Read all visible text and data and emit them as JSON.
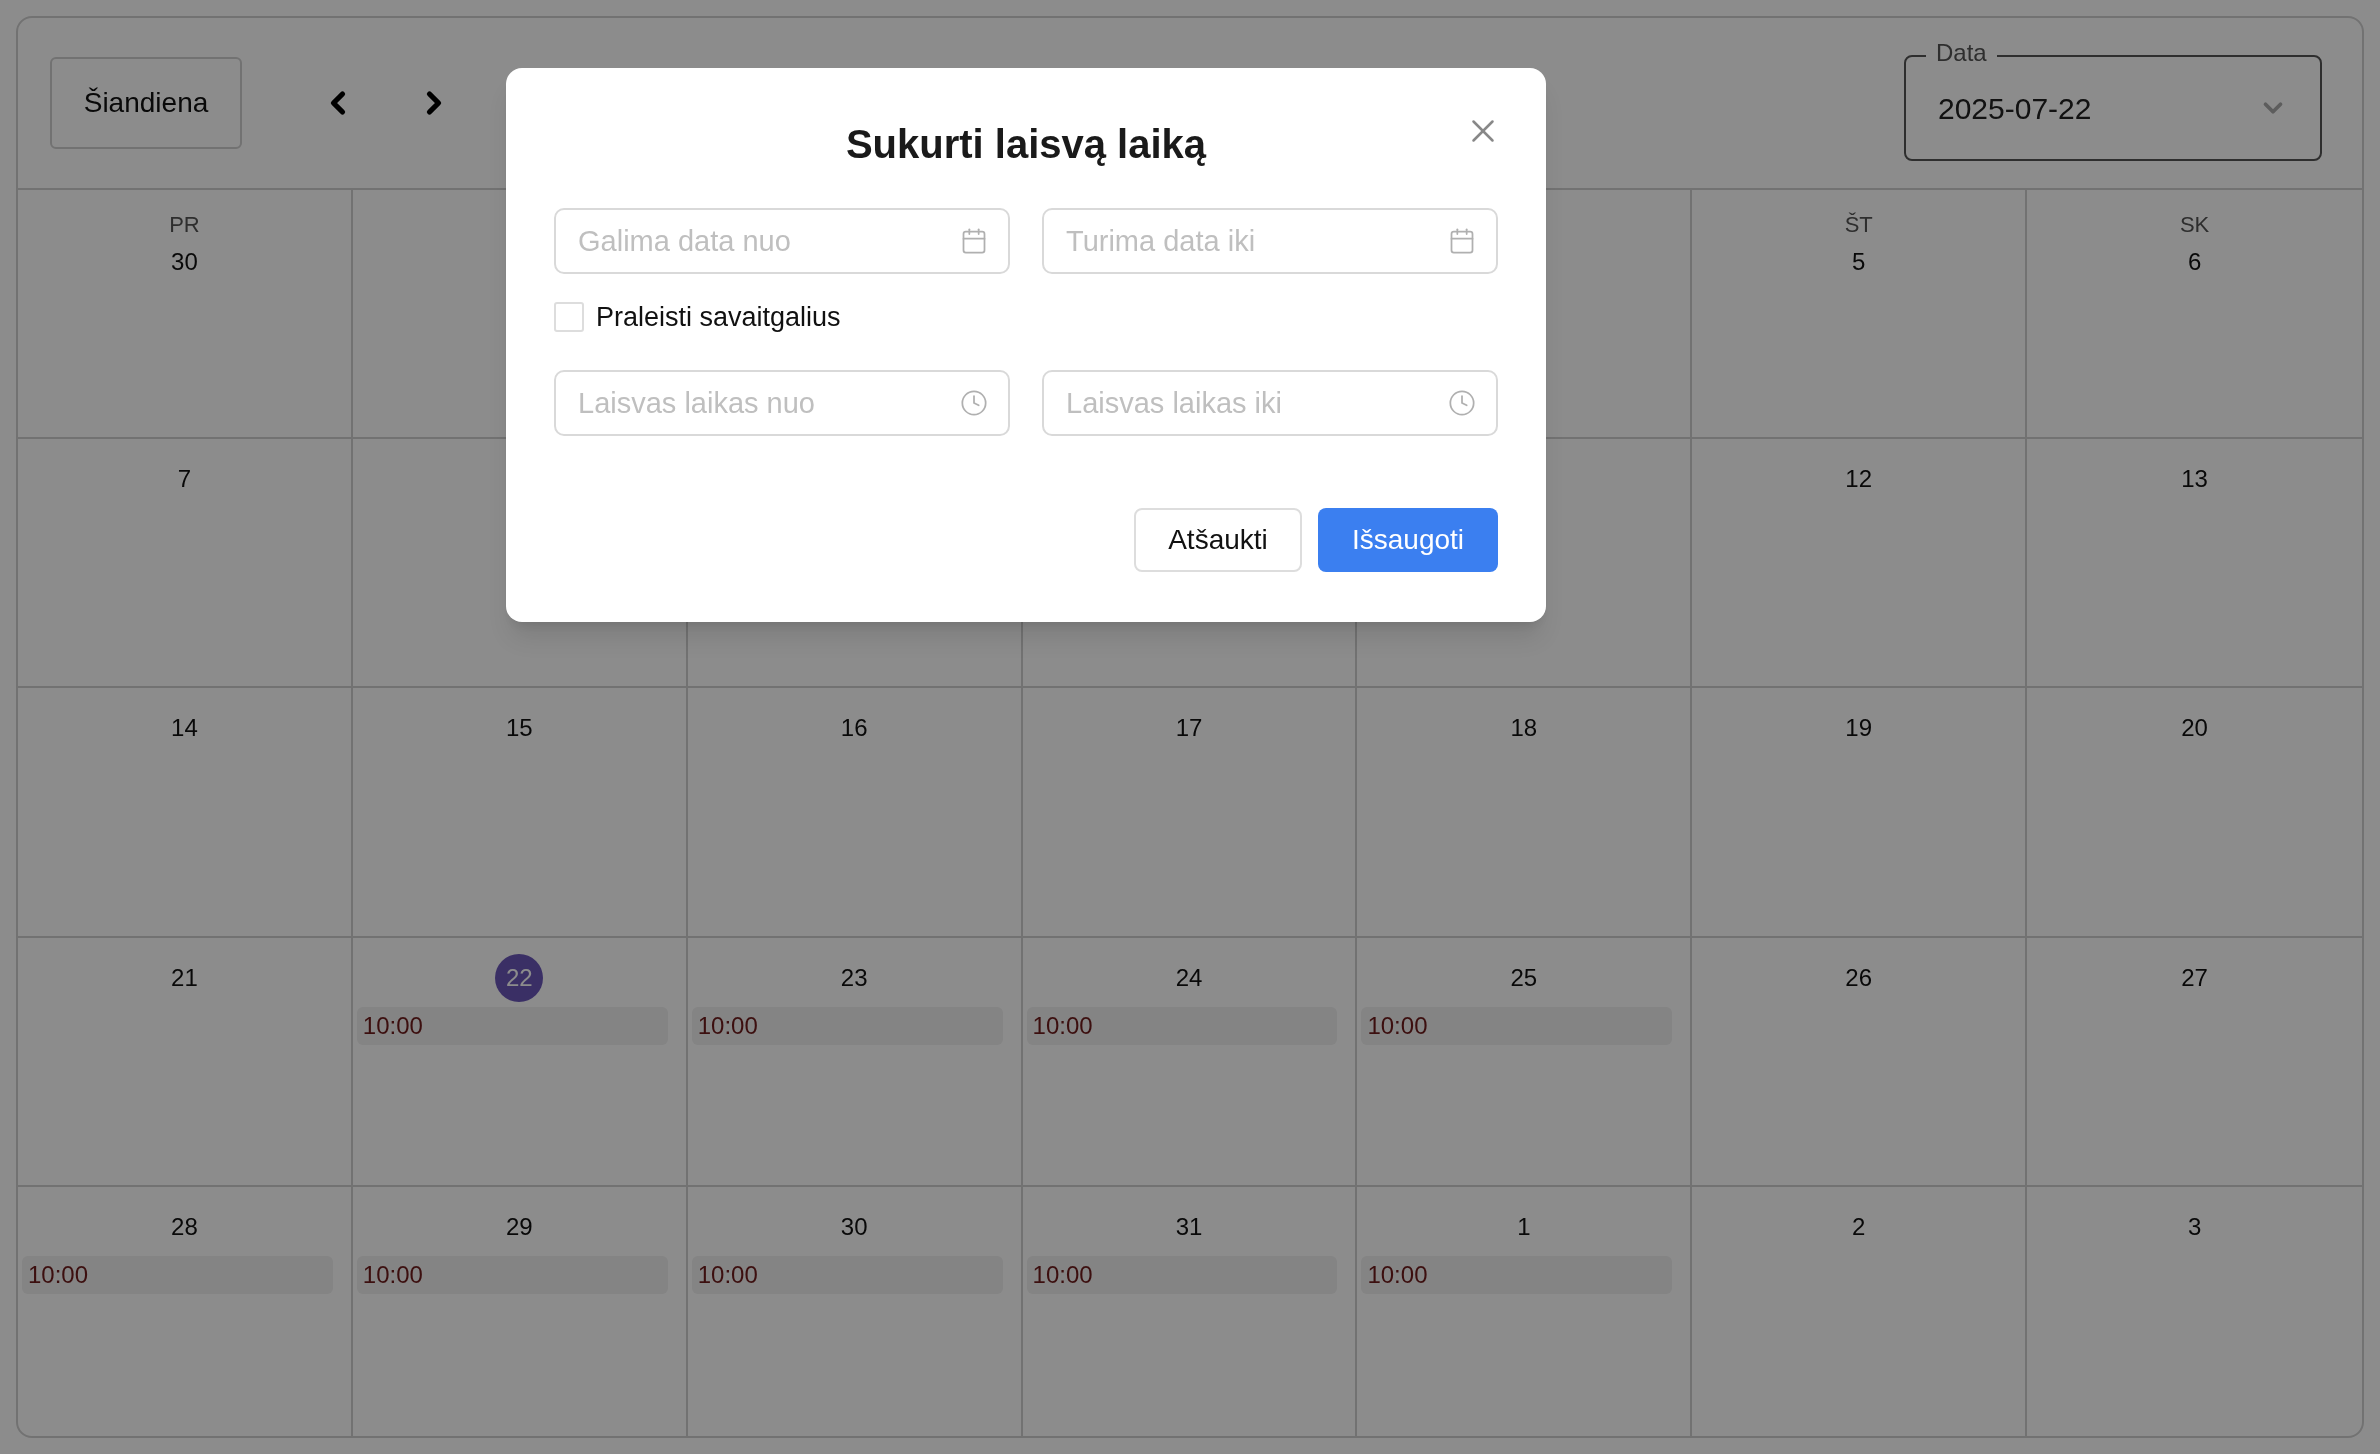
{
  "toolbar": {
    "today_button": "Šiandiena",
    "date_field": {
      "legend": "Data",
      "value": "2025-07-22"
    }
  },
  "weeks": [
    {
      "days": [
        {
          "kind": "day",
          "weekday": "PR",
          "day": "30"
        },
        {
          "kind": "covered"
        },
        {
          "kind": "covered"
        },
        {
          "kind": "covered"
        },
        {
          "kind": "covered"
        },
        {
          "kind": "day",
          "weekday": "ŠT",
          "day": "5"
        },
        {
          "kind": "day",
          "weekday": "SK",
          "day": "6"
        }
      ]
    },
    {
      "days": [
        {
          "kind": "day",
          "day": "7"
        },
        {
          "kind": "covered"
        },
        {
          "kind": "covered"
        },
        {
          "kind": "covered"
        },
        {
          "kind": "covered"
        },
        {
          "kind": "day",
          "day": "12"
        },
        {
          "kind": "day",
          "day": "13"
        }
      ]
    },
    {
      "days": [
        {
          "day": "14"
        },
        {
          "day": "15"
        },
        {
          "day": "16"
        },
        {
          "day": "17"
        },
        {
          "day": "18"
        },
        {
          "day": "19"
        },
        {
          "day": "20"
        }
      ]
    },
    {
      "days": [
        {
          "day": "21",
          "today": false
        },
        {
          "day": "22",
          "today": true,
          "events": [
            "10:00"
          ]
        },
        {
          "day": "23",
          "today": false,
          "events": [
            "10:00"
          ]
        },
        {
          "day": "24",
          "today": false,
          "events": [
            "10:00"
          ]
        },
        {
          "day": "25",
          "today": false,
          "events": [
            "10:00"
          ]
        },
        {
          "day": "26",
          "today": false
        },
        {
          "day": "27",
          "today": false
        }
      ]
    },
    {
      "days": [
        {
          "day": "28",
          "events": [
            "10:00"
          ]
        },
        {
          "day": "29",
          "events": [
            "10:00"
          ]
        },
        {
          "day": "30",
          "events": [
            "10:00"
          ]
        },
        {
          "day": "31",
          "events": [
            "10:00"
          ]
        },
        {
          "day": "1",
          "events": [
            "10:00"
          ]
        },
        {
          "day": "2"
        },
        {
          "day": "3"
        }
      ]
    }
  ],
  "dialog": {
    "title": "Sukurti laisvą laiką",
    "fields": [
      {
        "kind": "date",
        "placeholder": "Galima data nuo"
      },
      {
        "kind": "date",
        "placeholder": "Turima data iki"
      }
    ],
    "checkbox": {
      "label": "Praleisti savaitgalius",
      "checked": false
    },
    "time_fields": [
      {
        "kind": "time",
        "placeholder": "Laisvas laikas nuo"
      },
      {
        "kind": "time",
        "placeholder": "Laisvas laikas iki"
      }
    ],
    "buttons": [
      {
        "kind": "secondary",
        "label": "Atšaukti"
      },
      {
        "kind": "primary",
        "label": "Išsaugoti"
      }
    ]
  }
}
